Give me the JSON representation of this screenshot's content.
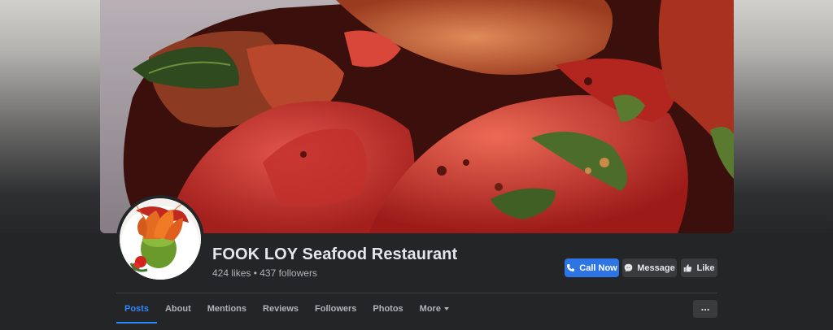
{
  "page": {
    "name": "FOOK LOY Seafood Restaurant",
    "stats": "424 likes • 437 followers"
  },
  "actions": {
    "call_label": "Call Now",
    "message_label": "Message",
    "like_label": "Like"
  },
  "tabs": [
    {
      "label": "Posts",
      "active": true
    },
    {
      "label": "About",
      "active": false
    },
    {
      "label": "Mentions",
      "active": false
    },
    {
      "label": "Reviews",
      "active": false
    },
    {
      "label": "Followers",
      "active": false
    },
    {
      "label": "Photos",
      "active": false
    },
    {
      "label": "More",
      "active": false,
      "has_dropdown": true
    }
  ],
  "more_menu_glyph": "...",
  "icons": {
    "call": "phone-icon",
    "message": "messenger-icon",
    "like": "thumbs-up-icon",
    "more_tab": "caret-down-icon",
    "options": "ellipsis-icon"
  },
  "colors": {
    "accent": "#2d88ff",
    "call_button": "#2d74e5",
    "panel": "#242526",
    "text_primary": "#e4e6eb",
    "text_secondary": "#b0b3b8"
  }
}
